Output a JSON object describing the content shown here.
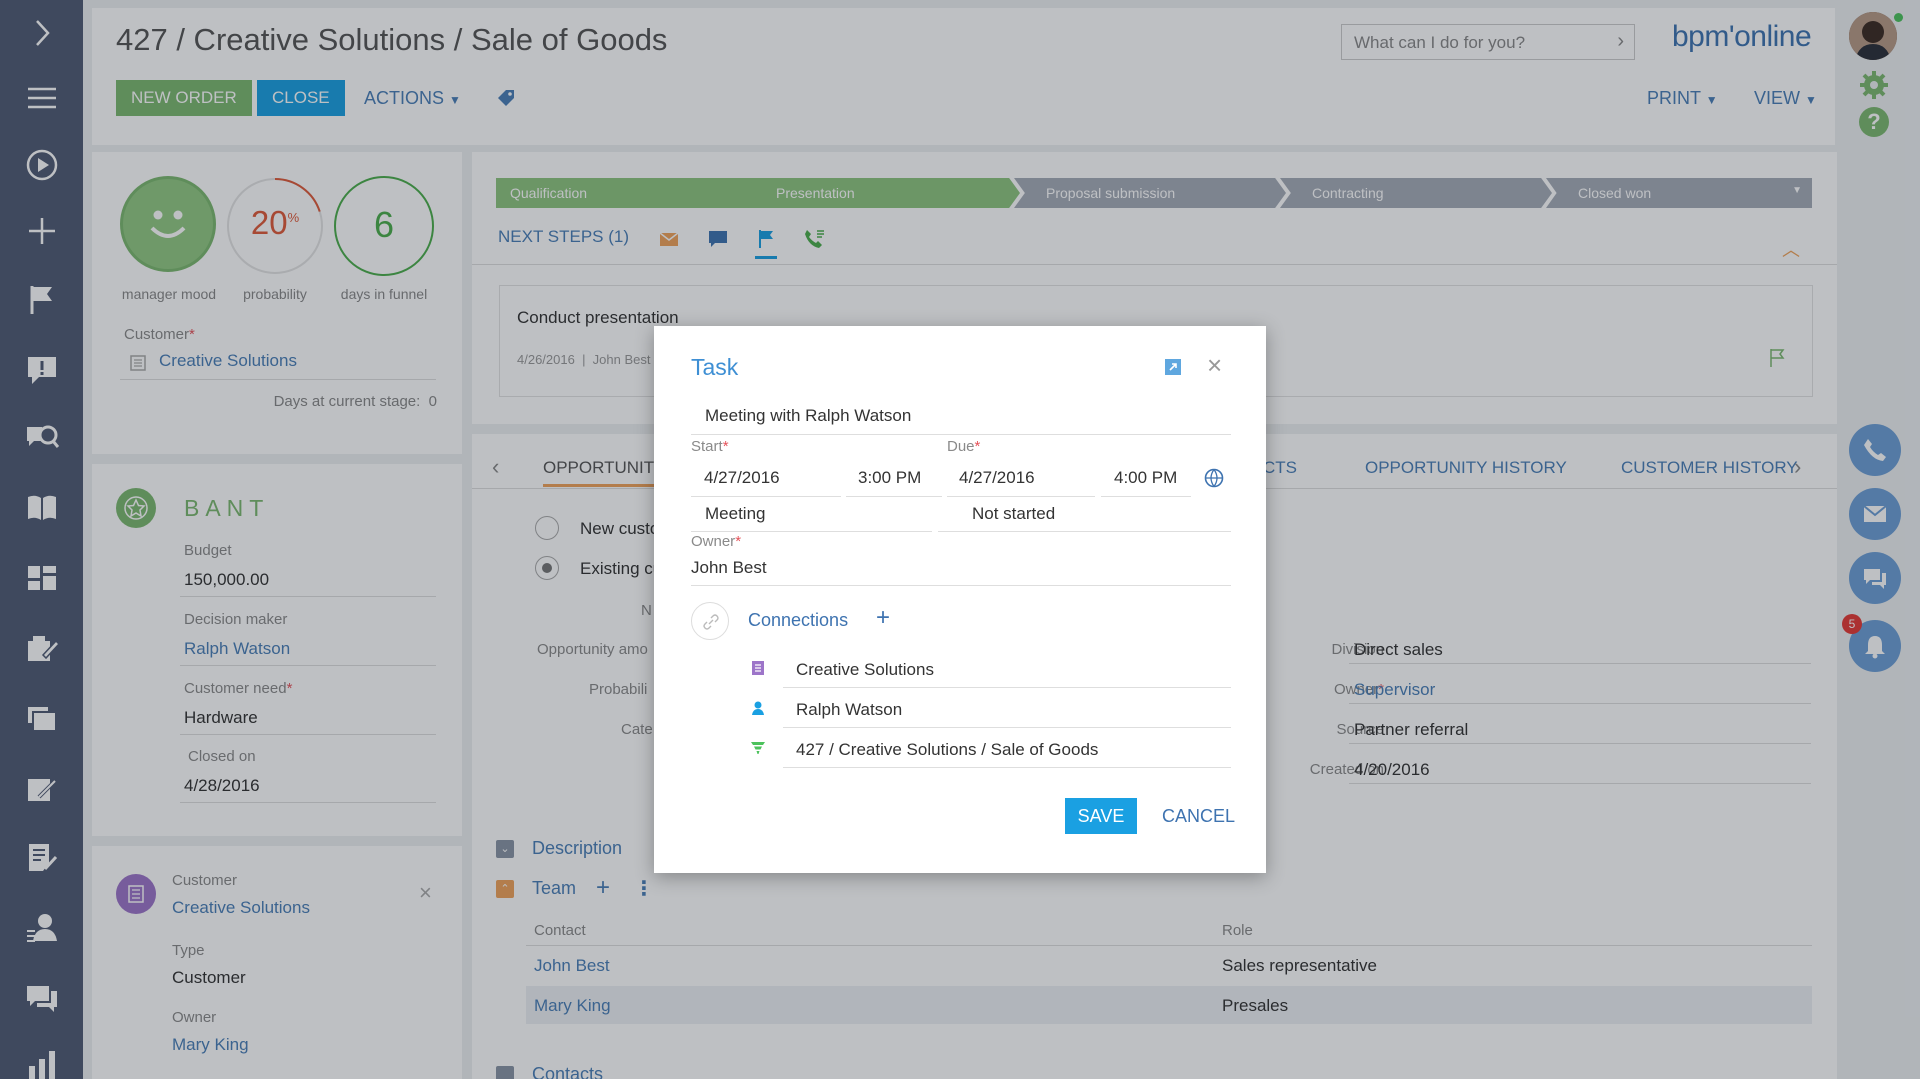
{
  "header": {
    "title": "427 / Creative Solutions / Sale of Goods",
    "search_placeholder": "What can I do for you?",
    "logo": "bpm'online",
    "new_order": "NEW ORDER",
    "close": "CLOSE",
    "actions": "ACTIONS",
    "print": "PRINT",
    "view": "VIEW"
  },
  "metrics": {
    "mood_label": "manager mood",
    "probability_value": "20",
    "probability_unit": "%",
    "probability_label": "probability",
    "probability_fraction": 0.2,
    "days_value": "6",
    "days_label": "days in funnel"
  },
  "customer": {
    "label": "Customer",
    "value": "Creative Solutions",
    "days_stage_label": "Days at current stage:",
    "days_stage_value": "0"
  },
  "bant": {
    "title": "BANT",
    "budget_label": "Budget",
    "budget_value": "150,000.00",
    "decision_label": "Decision maker",
    "decision_value": "Ralph Watson",
    "need_label": "Customer need",
    "need_value": "Hardware",
    "closed_label": "Closed on",
    "closed_value": "4/28/2016"
  },
  "customer_card": {
    "label": "Customer",
    "name": "Creative Solutions",
    "type_label": "Type",
    "type_value": "Customer",
    "owner_label": "Owner",
    "owner_value": "Mary King"
  },
  "stages": [
    "Qualification",
    "Presentation",
    "Proposal submission",
    "Contracting",
    "Closed won"
  ],
  "next_steps": {
    "label": "NEXT STEPS (1)",
    "activity_title": "Conduct presentation",
    "activity_date": "4/26/2016",
    "activity_owner": "John Best"
  },
  "tabs": {
    "opportunity": "OPPORTUNITY",
    "products_partial": "CTS",
    "history": "OPPORTUNITY HISTORY",
    "customer_history": "CUSTOMER HISTORY"
  },
  "form": {
    "new_customer": "New custo",
    "existing_customer": "Existing cu",
    "name_partial": "N",
    "amount_partial": "Opportunity amo",
    "probability_partial": "Probabili",
    "category_partial": "Cate",
    "division_label": "Division",
    "division_value": "Direct sales",
    "owner_label": "Owner",
    "owner_value": "Supervisor",
    "source_label": "Source",
    "source_value": "Partner referral",
    "created_label": "Created on",
    "created_value": "4/20/2016"
  },
  "sections": {
    "description": "Description",
    "team": "Team",
    "contacts": "Contacts"
  },
  "team_table": {
    "headers": [
      "Contact",
      "Role"
    ],
    "rows": [
      [
        "John Best",
        "Sales representative"
      ],
      [
        "Mary King",
        "Presales"
      ]
    ]
  },
  "notifications_count": "5",
  "task_modal": {
    "title": "Task",
    "subject": "Meeting with Ralph Watson",
    "start_label": "Start",
    "start_date": "4/27/2016",
    "start_time": "3:00 PM",
    "due_label": "Due",
    "due_date": "4/27/2016",
    "due_time": "4:00 PM",
    "category": "Meeting",
    "status": "Not started",
    "owner_label": "Owner",
    "owner_value": "John Best",
    "connections_label": "Connections",
    "connections": [
      "Creative Solutions",
      "Ralph Watson",
      "427 / Creative Solutions / Sale of Goods"
    ],
    "save": "SAVE",
    "cancel": "CANCEL"
  },
  "colors": {
    "nav_bg": "#505a73",
    "green": "#7cb96f",
    "blue_btn": "#1aa0e2",
    "link": "#4a7fb7",
    "stage_inactive": "#a5acb8"
  }
}
